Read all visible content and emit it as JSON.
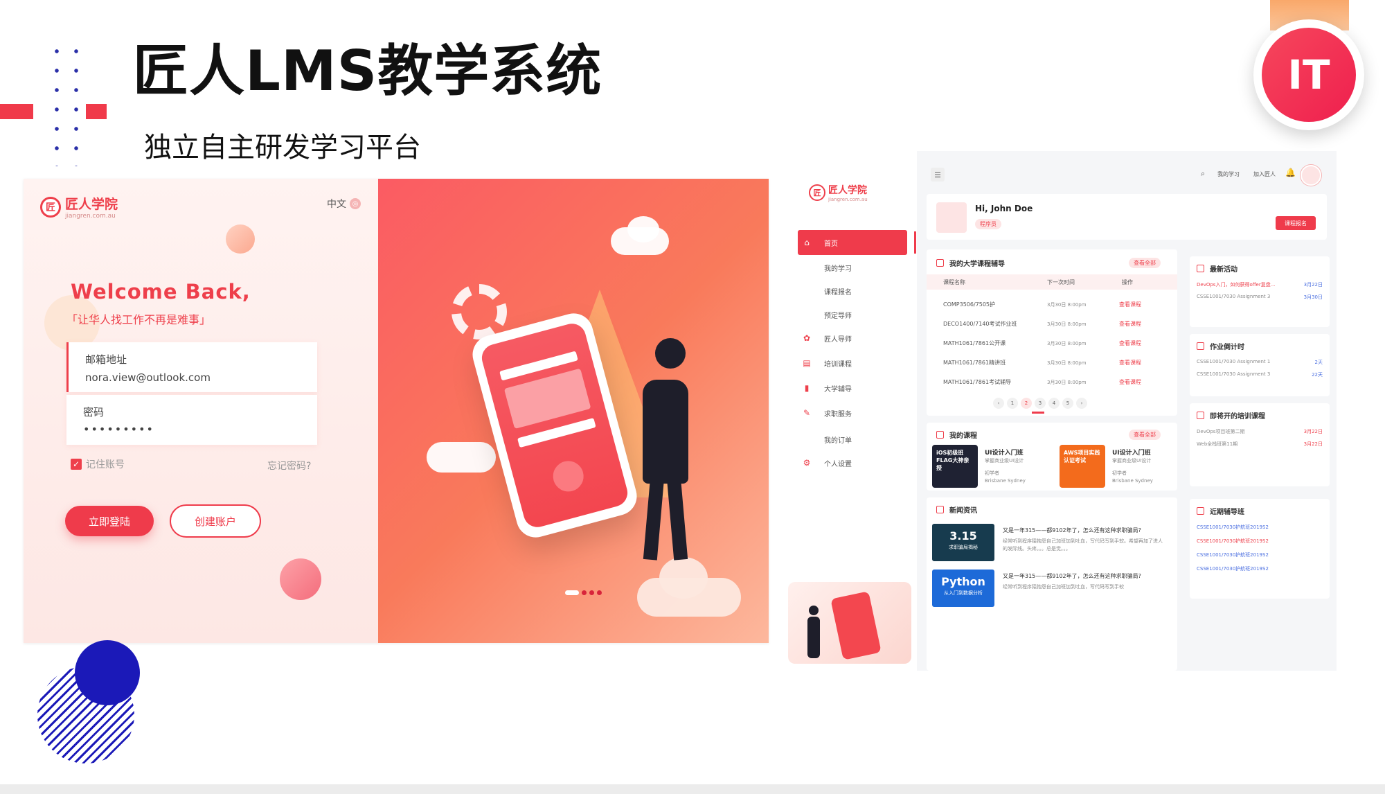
{
  "slide": {
    "title": "匠人LMS教学系统",
    "subtitle": "独立自主研发学习平台",
    "logo_text": "IT"
  },
  "login": {
    "brand_mark": "匠",
    "brand_name": "匠人学院",
    "brand_url": "jiangren.com.au",
    "language": "中文",
    "welcome": "Welcome Back,",
    "slogan": "「让华人找工作不再是难事」",
    "email_label": "邮箱地址",
    "email_value": "nora.view@outlook.com",
    "password_label": "密码",
    "password_value": "•••••••••",
    "remember_label": "记住账号",
    "forgot_label": "忘记密码?",
    "login_button": "立即登陆",
    "create_button": "创建账户"
  },
  "dashboard": {
    "brand_mark": "匠",
    "brand_name": "匠人学院",
    "brand_url": "jiangren.com.au",
    "topbar": {
      "my_learning": "我的学习",
      "join": "加入匠人"
    },
    "nav": [
      {
        "label": "首页",
        "icon": "home-icon",
        "glyph": "⌂"
      },
      {
        "label": "我的学习",
        "icon": "",
        "glyph": ""
      },
      {
        "label": "课程报名",
        "icon": "",
        "glyph": ""
      },
      {
        "label": "预定导师",
        "icon": "",
        "glyph": ""
      },
      {
        "label": "匠人导师",
        "icon": "mentor-icon",
        "glyph": "✿"
      },
      {
        "label": "培训课程",
        "icon": "course-icon",
        "glyph": "▤"
      },
      {
        "label": "大学辅导",
        "icon": "book-icon",
        "glyph": "▮"
      },
      {
        "label": "求职服务",
        "icon": "job-icon",
        "glyph": "✎"
      },
      {
        "label": "我的订单",
        "icon": "",
        "glyph": ""
      },
      {
        "label": "个人设置",
        "icon": "settings-icon",
        "glyph": "⚙"
      }
    ],
    "greeting": "Hi, John Doe",
    "role": "程序员",
    "enroll_button": "课程报名",
    "tutoring": {
      "title": "我的大学课程辅导",
      "view_all": "查看全部",
      "columns": [
        "课程名称",
        "下一次时间",
        "操作"
      ],
      "rows": [
        {
          "name": "COMP3506/7505护",
          "time": "3月30日 8:00pm",
          "action": "查看课程"
        },
        {
          "name": "DECO1400/7140考试作业班",
          "time": "3月30日 8:00pm",
          "action": "查看课程"
        },
        {
          "name": "MATH1061/7861公开课",
          "time": "3月30日 8:00pm",
          "action": "查看课程"
        },
        {
          "name": "MATH1061/7861精讲班",
          "time": "3月30日 8:00pm",
          "action": "查看课程"
        },
        {
          "name": "MATH1061/7861考试辅导",
          "time": "3月30日 8:00pm",
          "action": "查看课程"
        }
      ],
      "pages": [
        "‹",
        "1",
        "2",
        "3",
        "4",
        "5",
        "›"
      ],
      "active_page": "2"
    },
    "my_courses": {
      "title": "我的课程",
      "view_all": "查看全部",
      "items": [
        {
          "title": "UI设计入门班",
          "desc": "掌握商业级UI设计",
          "level": "初学者",
          "city": "Brisbane Sydney",
          "thumb": "iOS初级班\nFLAG大神亲授"
        },
        {
          "title": "UI设计入门班",
          "desc": "掌握商业级UI设计",
          "level": "初学者",
          "city": "Brisbane Sydney",
          "thumb": "AWS项目实践\n认证考试"
        }
      ]
    },
    "news": {
      "title": "新闻资讯",
      "items": [
        {
          "thumb": "3.15",
          "thumb_sub": "求职骗局揭秘",
          "headline": "又是一年315——都9102年了，怎么还有这种求职骗局?",
          "body": "经常听到程序猿抱怨自己加班加到吐血，写代码写到手软。希望再加了进人的发际线。头疼。。。总是觉。。。"
        },
        {
          "thumb": "Python",
          "thumb_sub": "从入门到数据分析",
          "headline": "又是一年315——都9102年了，怎么还有这种求职骗局?",
          "body": "经常听到程序猿抱怨自己加班加到吐血，写代码写到手软"
        }
      ]
    },
    "activities": {
      "title": "最新活动",
      "items": [
        {
          "text": "DevOps入门，如何获得offer复盘...",
          "date": "3月22日",
          "red": true
        },
        {
          "text": "CSSE1001/7030 Assignment 3",
          "date": "3月30日",
          "red": false
        }
      ]
    },
    "homework": {
      "title": "作业倒计时",
      "items": [
        {
          "text": "CSSE1001/7030 Assignment 1",
          "days": "2天"
        },
        {
          "text": "CSSE1001/7030 Assignment 3",
          "days": "22天"
        }
      ]
    },
    "upcoming": {
      "title": "即将开的培训课程",
      "items": [
        {
          "text": "DevOps项目班第二期",
          "date": "3月22日"
        },
        {
          "text": "Web全栈班第11期",
          "date": "3月22日"
        }
      ]
    },
    "recent_tutoring": {
      "title": "近期辅导班",
      "items": [
        "CSSE1001/7030护航班2019S2",
        "CSSE1001/7030护航班2019S2",
        "CSSE1001/7030护航班2019S2",
        "CSSE1001/7030护航班2019S2"
      ]
    }
  },
  "colors": {
    "accent": "#ef3b4b",
    "navy": "#1b19b8",
    "link_blue": "#4a6ee0"
  }
}
